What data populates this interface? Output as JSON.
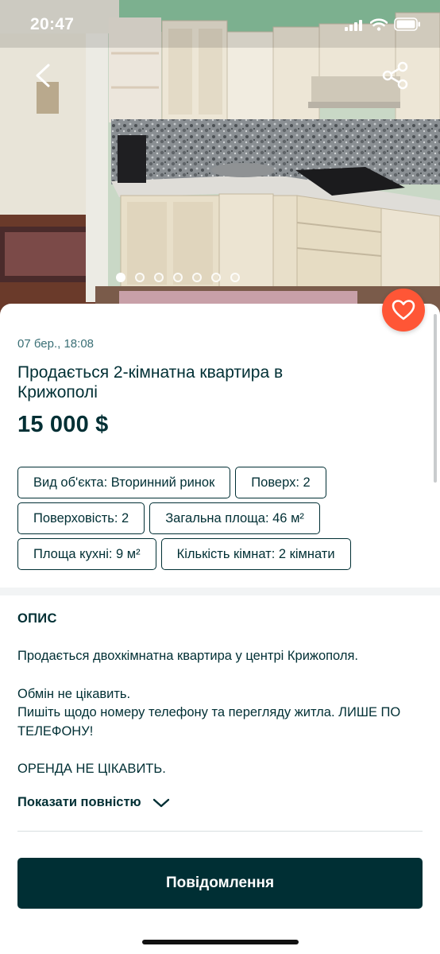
{
  "status_bar": {
    "time": "20:47"
  },
  "hero": {
    "image_count": 7,
    "active_index": 0,
    "icons": {
      "back": "chevron-left-icon",
      "share": "share-icon",
      "favorite": "heart-icon"
    }
  },
  "listing": {
    "date": "07 бер., 18:08",
    "title": "Продається 2-кімнатна квартира в Крижополі",
    "price": "15 000 $",
    "params": [
      [
        "Вид об'єкта: Вторинний ринок",
        "Поверх: 2"
      ],
      [
        "Поверховість: 2",
        "Загальна площа: 46 м²"
      ],
      [
        "Площа кухні: 9 м²",
        "Кількість кімнат: 2 кімнати"
      ]
    ]
  },
  "description": {
    "heading": "ОПИС",
    "line1": "Продається двохкімнатна квартира у центрі Крижополя.",
    "line2": "Обмін не цікавить.",
    "line3": "Пишіть щодо номеру телефону та перегляду житла. ЛИШЕ ПО ТЕЛЕФОНУ!",
    "line4": "ОРЕНДА НЕ ЦІКАВИТЬ.",
    "show_more": "Показати повністю"
  },
  "actions": {
    "message_button": "Повідомлення"
  },
  "colors": {
    "brand_dark": "#002f34",
    "favorite": "#ff5636",
    "date_text": "#3a6f75",
    "separator": "#f2f4f5"
  }
}
